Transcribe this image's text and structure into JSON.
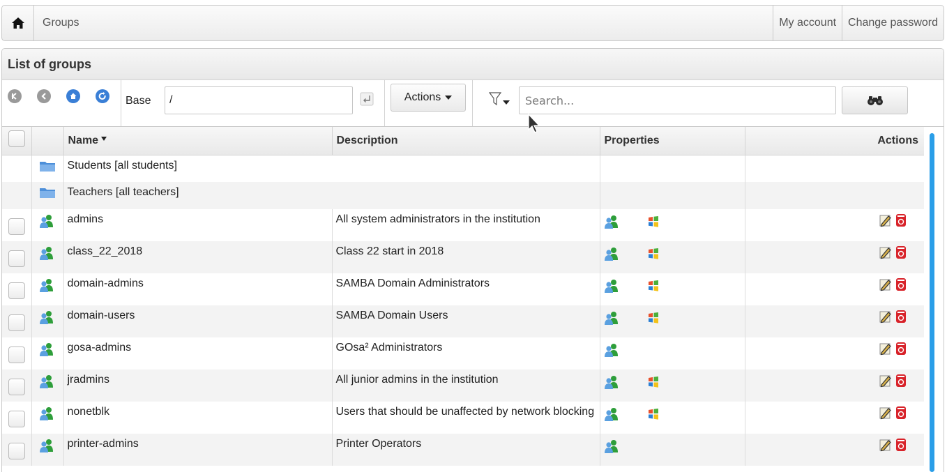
{
  "nav": {
    "breadcrumb": "Groups",
    "my_account": "My account",
    "change_password": "Change password"
  },
  "panel": {
    "title": "List of groups"
  },
  "toolbar": {
    "base_label": "Base",
    "base_value": "/",
    "actions_label": "Actions",
    "search_placeholder": "Search..."
  },
  "table": {
    "headers": {
      "name": "Name",
      "description": "Description",
      "properties": "Properties",
      "actions": "Actions"
    },
    "departments": [
      {
        "name": "Students [all students]"
      },
      {
        "name": "Teachers [all teachers]"
      }
    ],
    "rows": [
      {
        "name": "admins",
        "description": "All system administrators in the institution",
        "samba": true
      },
      {
        "name": "class_22_2018",
        "description": "Class 22 start in 2018",
        "samba": true
      },
      {
        "name": "domain-admins",
        "description": "SAMBA Domain Administrators",
        "samba": true
      },
      {
        "name": "domain-users",
        "description": "SAMBA Domain Users",
        "samba": true
      },
      {
        "name": "gosa-admins",
        "description": "GOsa² Administrators",
        "samba": false
      },
      {
        "name": "jradmins",
        "description": "All junior admins in the institution",
        "samba": true
      },
      {
        "name": "nonetblk",
        "description": "Users that should be unaffected by network blocking",
        "samba": true
      },
      {
        "name": "printer-admins",
        "description": "Printer Operators",
        "samba": false
      }
    ]
  },
  "colors": {
    "accent_blue": "#3a7fd6",
    "scrollbar": "#2a9ee8",
    "border": "#c9c9c9"
  },
  "icons": {
    "home": "home-icon",
    "group": "group-icon",
    "department": "folder-icon",
    "samba": "windows-icon",
    "edit": "edit-icon",
    "delete": "delete-icon",
    "search": "binoculars-icon",
    "filter": "filter-icon"
  }
}
